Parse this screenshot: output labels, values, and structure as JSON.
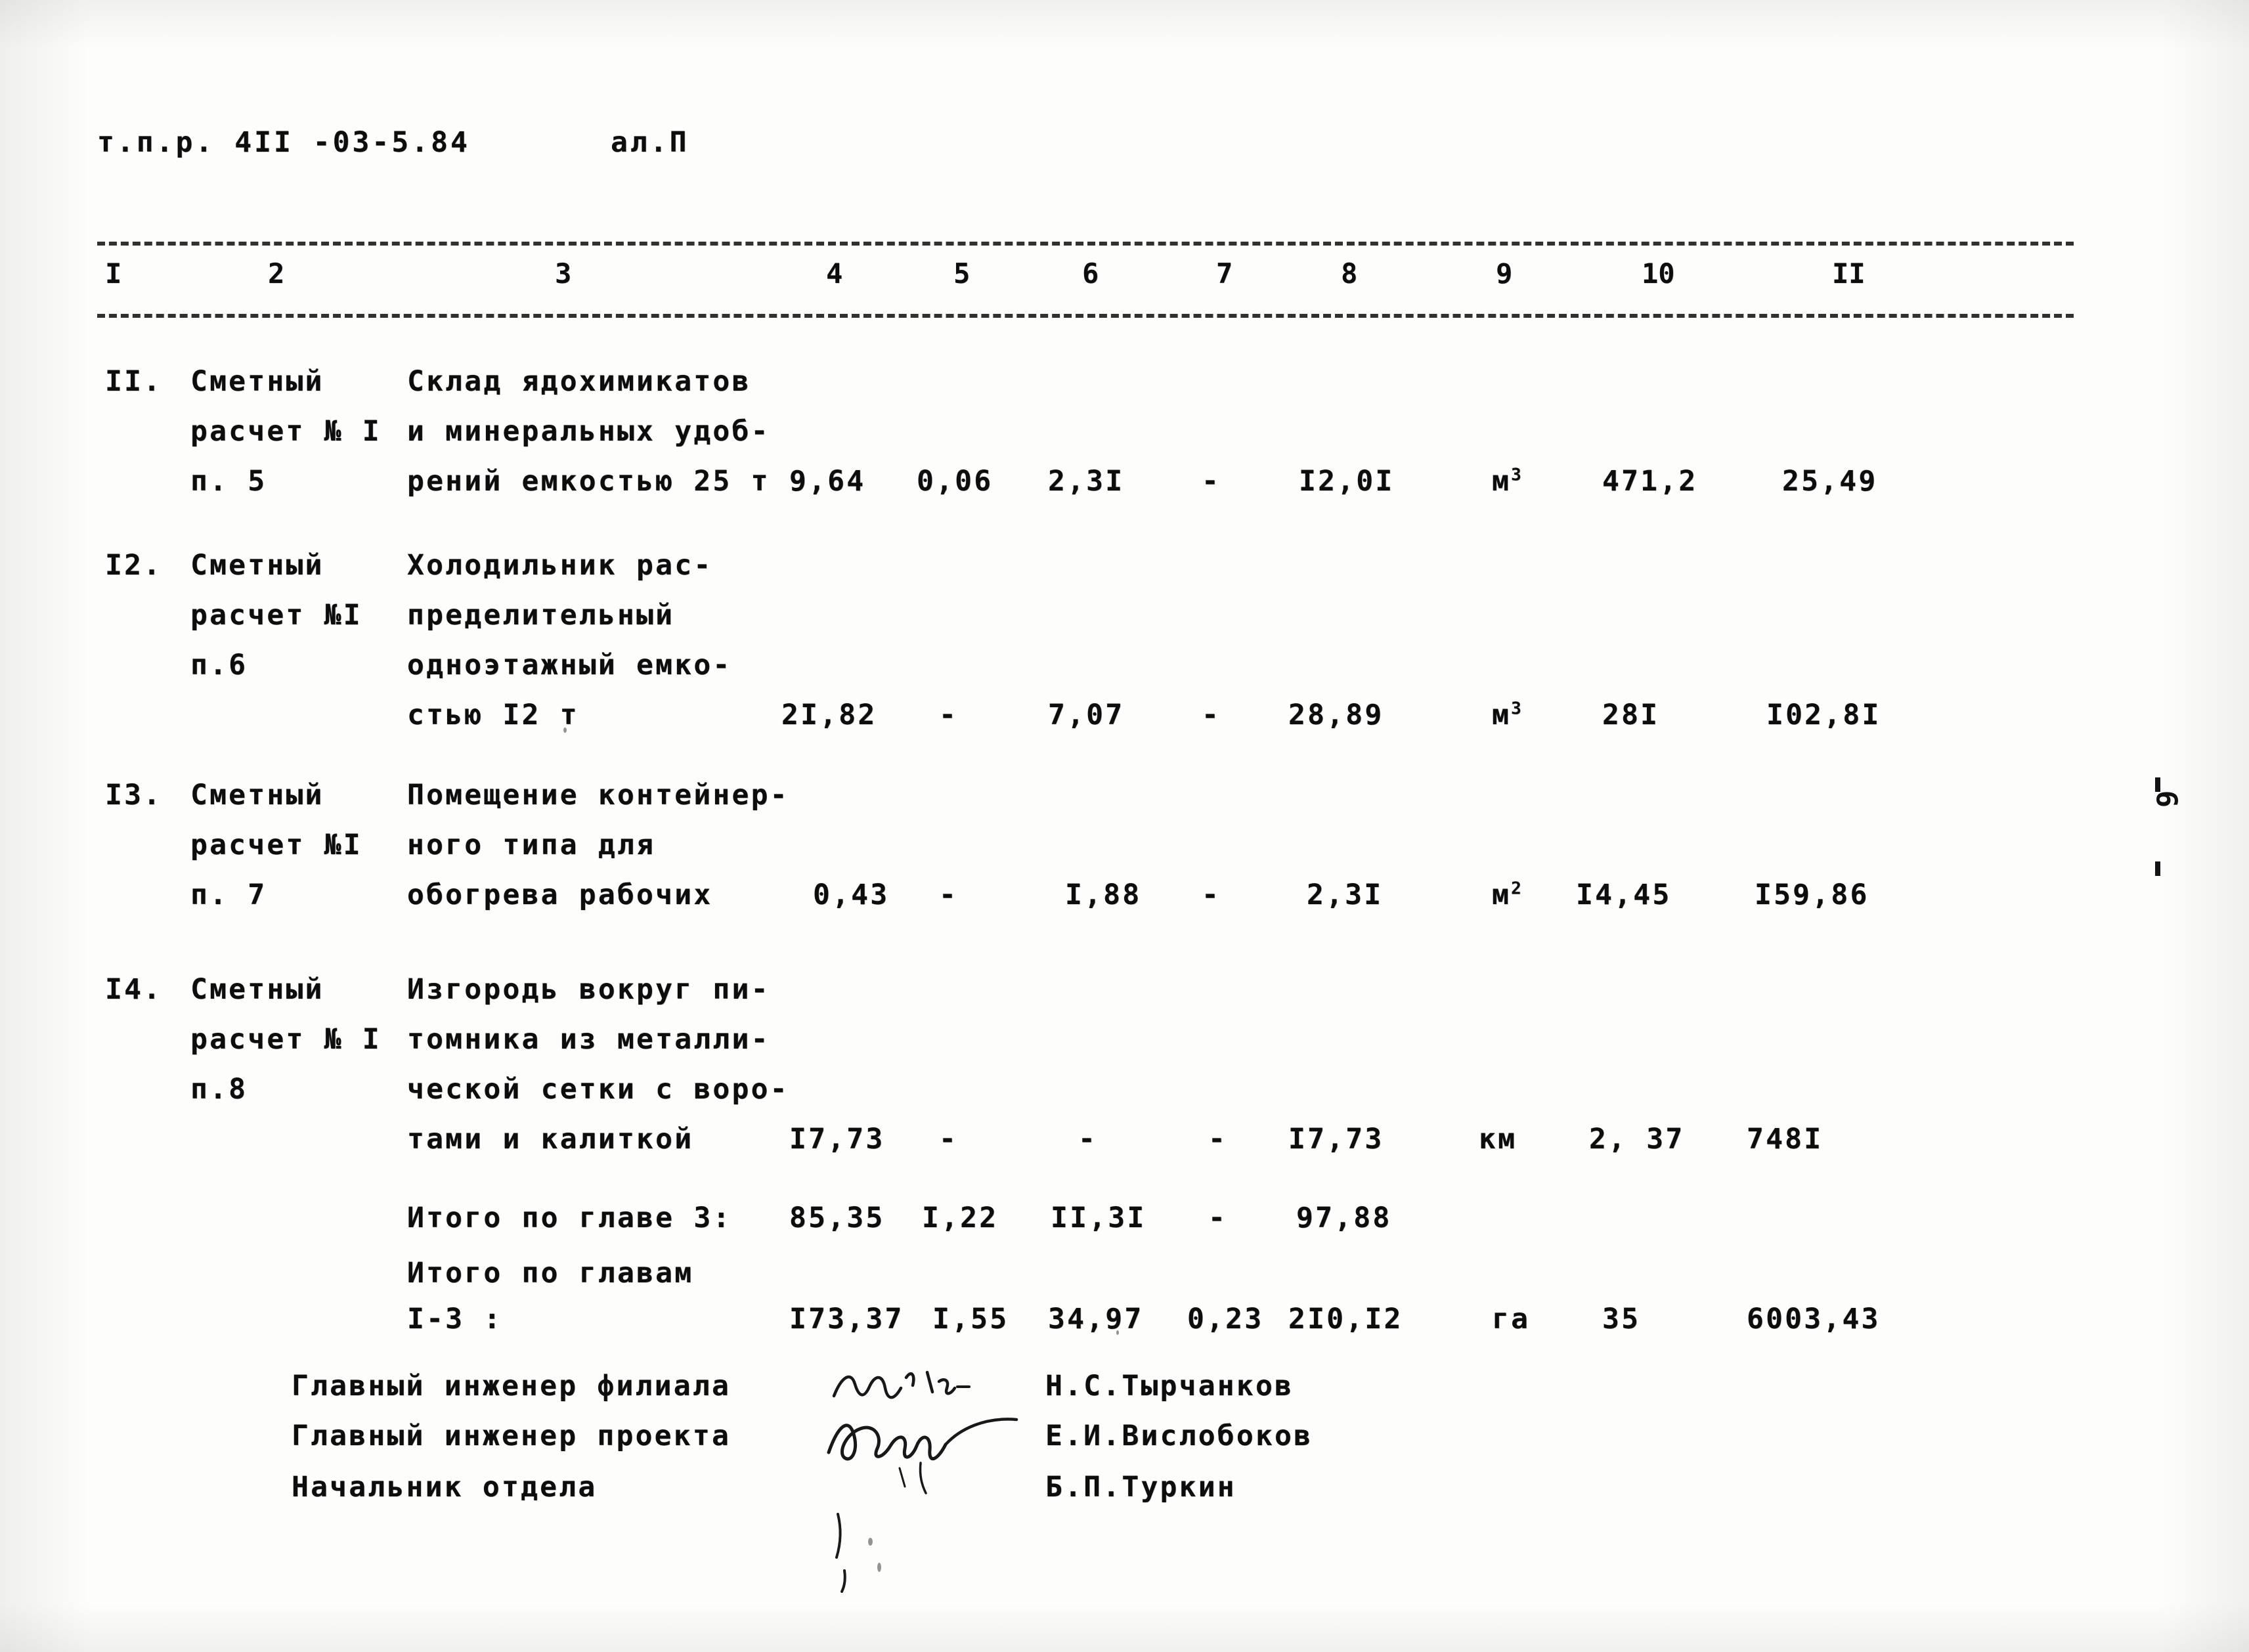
{
  "header": {
    "doc_code": "т.п.р. 4II -03-5.84",
    "album": "ал.П"
  },
  "page_number": "9",
  "table": {
    "column_numbers": [
      "I",
      "2",
      "3",
      "4",
      "5",
      "6",
      "7",
      "8",
      "9",
      "10",
      "II"
    ],
    "rows": [
      {
        "no": "II.",
        "ref_lines": [
          "Сметный",
          "расчет № I",
          "п. 5"
        ],
        "name_lines": [
          "Склад ядохимикатов",
          "и минеральных удоб-",
          "рений емкостью 25 т"
        ],
        "c4": "9,64",
        "c5": "0,06",
        "c6": "2,3I",
        "c7": "-",
        "c8": "I2,0I",
        "unit": "м",
        "unit_exp": "3",
        "c10": "471,2",
        "c11": "25,49"
      },
      {
        "no": "I2.",
        "ref_lines": [
          "Сметный",
          "расчет №I",
          "п.6"
        ],
        "name_lines": [
          "Холодильник рас-",
          "пределительный",
          "одноэтажный емко-",
          "стью I2 т"
        ],
        "c4": "2I,82",
        "c5": "-",
        "c6": "7,07",
        "c7": "-",
        "c8": "28,89",
        "unit": "м",
        "unit_exp": "3",
        "c10": "28I",
        "c11": "I02,8I"
      },
      {
        "no": "I3.",
        "ref_lines": [
          "Сметный",
          "расчет №I",
          "п. 7"
        ],
        "name_lines": [
          "Помещение контейнер-",
          "ного типа для",
          "обогрева рабочих"
        ],
        "c4": "0,43",
        "c5": "-",
        "c6": "I,88",
        "c7": "-",
        "c8": "2,3I",
        "unit": "м",
        "unit_exp": "2",
        "c10": "I4,45",
        "c11": "I59,86"
      },
      {
        "no": "I4.",
        "ref_lines": [
          "Сметный",
          "расчет № I",
          "п.8"
        ],
        "name_lines": [
          "Изгородь вокруг пи-",
          "томника из металли-",
          "ческой сетки с воро-",
          "тами и калиткой"
        ],
        "c4": "I7,73",
        "c5": "-",
        "c6": "-",
        "c7": "-",
        "c8": "I7,73",
        "unit": "км",
        "unit_exp": "",
        "c10": "2, 37",
        "c11": "748I"
      }
    ],
    "totals": [
      {
        "label_lines": [
          "Итого по главе 3:"
        ],
        "c4": "85,35",
        "c5": "I,22",
        "c6": "II,3I",
        "c7": "-",
        "c8": "97,88",
        "unit": "",
        "c10": "",
        "c11": ""
      },
      {
        "label_lines": [
          "Итого по главам",
          "I-3 :"
        ],
        "c4": "I73,37",
        "c5": "I,55",
        "c6": "34,97",
        "c7": "0,23",
        "c8": "2I0,I2",
        "unit": "га",
        "c10": "35",
        "c11": "6003,43"
      }
    ]
  },
  "signatures": [
    {
      "title": "Главный инженер филиала",
      "name": "Н.С.Тырчанков"
    },
    {
      "title": "Главный инженер проекта",
      "name": "Е.И.Вислобоков"
    },
    {
      "title": "Начальник отдела",
      "name": "Б.П.Туркин"
    }
  ]
}
